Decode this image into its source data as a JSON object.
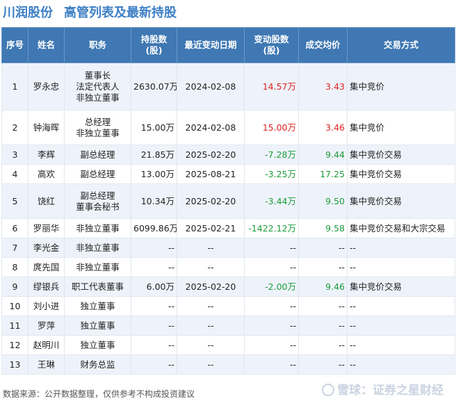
{
  "header": {
    "company": "川润股份",
    "title": "高管列表及最新持股"
  },
  "table": {
    "columns": [
      "序号",
      "姓名",
      "职务",
      "持股数\n(股)",
      "最近变动日期",
      "变动股数\n(股)",
      "成交均价",
      "交易方式"
    ],
    "rows": [
      {
        "no": "1",
        "name": "罗永忠",
        "roles": [
          "董事长",
          "法定代表人",
          "非独立董事"
        ],
        "shares": "2630.07万",
        "date": "2024-02-08",
        "change": "14.57万",
        "change_sign": "pos",
        "price": "3.43",
        "price_sign": "pos",
        "method": "集中竞价"
      },
      {
        "no": "2",
        "name": "钟海晖",
        "roles": [
          "总经理",
          "非独立董事"
        ],
        "shares": "15.00万",
        "date": "2024-02-08",
        "change": "15.00万",
        "change_sign": "pos",
        "price": "3.46",
        "price_sign": "pos",
        "method": "集中竞价"
      },
      {
        "no": "3",
        "name": "李辉",
        "roles": [
          "副总经理"
        ],
        "shares": "21.85万",
        "date": "2025-02-20",
        "change": "-7.28万",
        "change_sign": "neg",
        "price": "9.44",
        "price_sign": "neg",
        "method": "集中竞价交易"
      },
      {
        "no": "4",
        "name": "高欢",
        "roles": [
          "副总经理"
        ],
        "shares": "13.00万",
        "date": "2025-08-21",
        "change": "-3.25万",
        "change_sign": "neg",
        "price": "17.25",
        "price_sign": "neg",
        "method": "集中竞价交易"
      },
      {
        "no": "5",
        "name": "饶红",
        "roles": [
          "副总经理",
          "董事会秘书"
        ],
        "shares": "10.34万",
        "date": "2025-02-20",
        "change": "-3.44万",
        "change_sign": "neg",
        "price": "9.50",
        "price_sign": "neg",
        "method": "集中竞价交易"
      },
      {
        "no": "6",
        "name": "罗丽华",
        "roles": [
          "非独立董事"
        ],
        "shares": "6099.86万",
        "date": "2025-02-21",
        "change": "-1422.12万",
        "change_sign": "neg",
        "price": "9.58",
        "price_sign": "neg",
        "method": "集中竞价交易和大宗交易"
      },
      {
        "no": "7",
        "name": "李光金",
        "roles": [
          "非独立董事"
        ],
        "shares": "--",
        "date": "--",
        "change": "--",
        "change_sign": "",
        "price": "--",
        "price_sign": "",
        "method": "--"
      },
      {
        "no": "8",
        "name": "庹先国",
        "roles": [
          "非独立董事"
        ],
        "shares": "--",
        "date": "--",
        "change": "--",
        "change_sign": "",
        "price": "--",
        "price_sign": "",
        "method": "--"
      },
      {
        "no": "9",
        "name": "缪银兵",
        "roles": [
          "职工代表董事"
        ],
        "shares": "6.00万",
        "date": "2025-02-20",
        "change": "-2.00万",
        "change_sign": "neg",
        "price": "9.46",
        "price_sign": "neg",
        "method": "集中竞价交易"
      },
      {
        "no": "10",
        "name": "刘小进",
        "roles": [
          "独立董事"
        ],
        "shares": "--",
        "date": "--",
        "change": "--",
        "change_sign": "",
        "price": "--",
        "price_sign": "",
        "method": "--"
      },
      {
        "no": "11",
        "name": "罗萍",
        "roles": [
          "独立董事"
        ],
        "shares": "--",
        "date": "--",
        "change": "--",
        "change_sign": "",
        "price": "--",
        "price_sign": "",
        "method": "--"
      },
      {
        "no": "12",
        "name": "赵明川",
        "roles": [
          "独立董事"
        ],
        "shares": "--",
        "date": "--",
        "change": "--",
        "change_sign": "",
        "price": "--",
        "price_sign": "",
        "method": "--"
      },
      {
        "no": "13",
        "name": "王琳",
        "roles": [
          "财务总监"
        ],
        "shares": "--",
        "date": "--",
        "change": "--",
        "change_sign": "",
        "price": "--",
        "price_sign": "",
        "method": "--"
      }
    ]
  },
  "footer": {
    "source": "数据来源：公开数据整理，仅供参考不构成投资建议",
    "brand": "雪球：证券之星财经"
  },
  "watermarks": [
    "证券之星",
    "证券之星",
    "证券之星"
  ],
  "colors": {
    "header_bg": "#3f78b3",
    "title": "#3d7fc4",
    "positive": "#e02020",
    "negative": "#1a9b3a",
    "row_alt": "#eef3fb"
  }
}
